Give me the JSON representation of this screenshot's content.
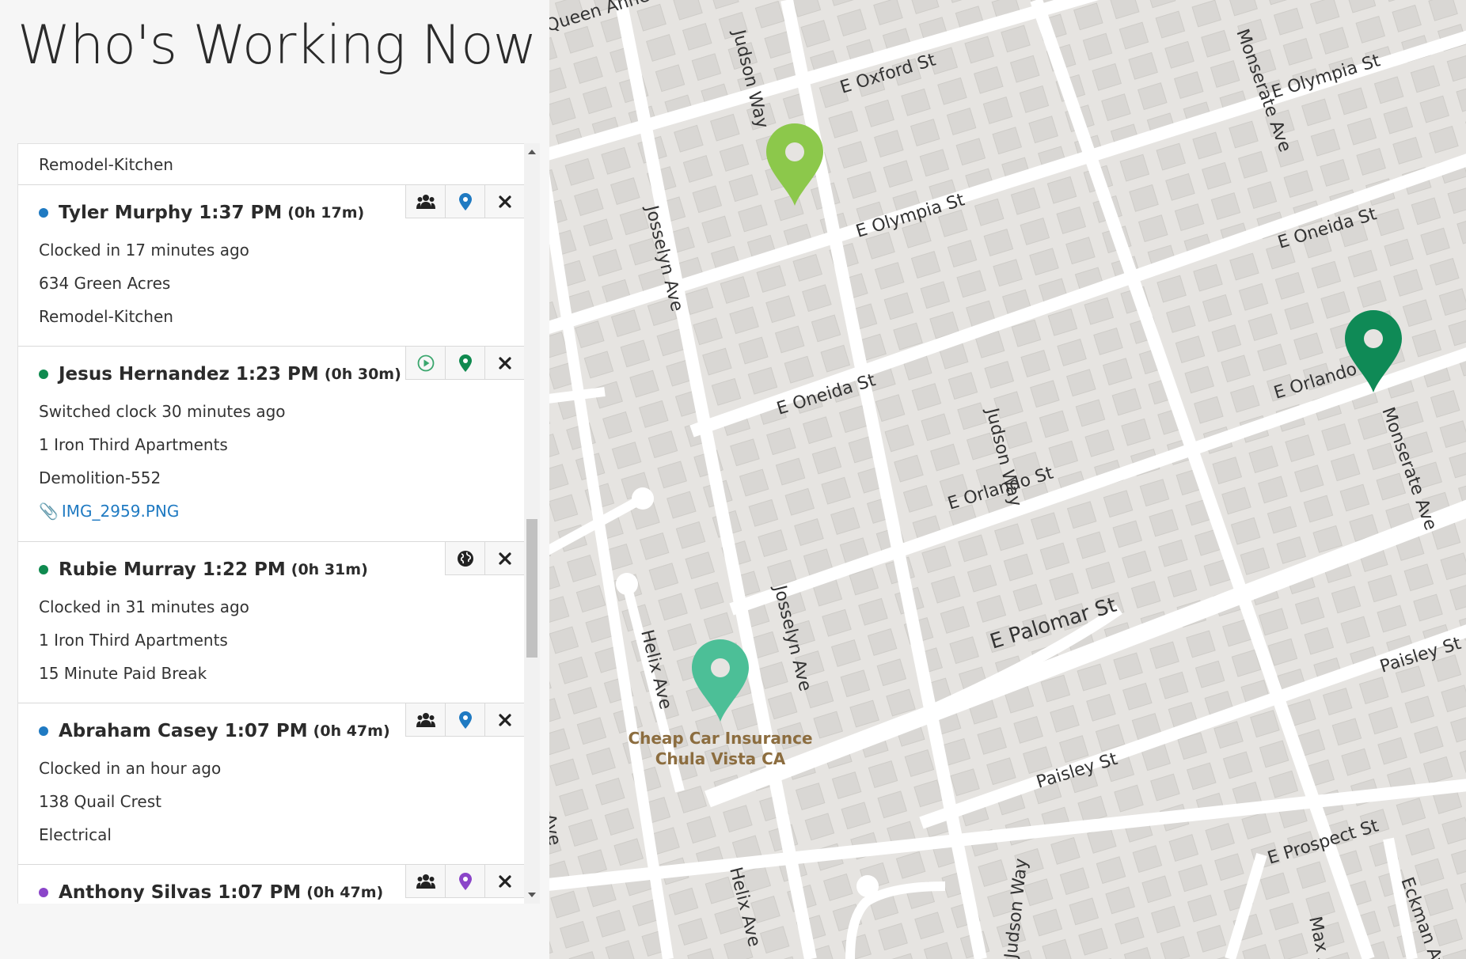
{
  "page": {
    "title": "Who's Working Now"
  },
  "top_entry": {
    "job": "Remodel-Kitchen"
  },
  "employees": [
    {
      "name": "Tyler Murphy",
      "clock_time": "1:37 PM",
      "duration": "(0h 17m)",
      "dot_color": "#1f7ac2",
      "status": "Clocked in 17 minutes ago",
      "location": "634 Green Acres",
      "job": "Remodel-Kitchen",
      "actions": [
        "group-icon",
        "map-pin-icon",
        "close-icon"
      ]
    },
    {
      "name": "Jesus Hernandez",
      "clock_time": "1:23 PM",
      "duration": "(0h 30m)",
      "dot_color": "#0f8a4f",
      "status": "Switched clock 30 minutes ago",
      "location": "1 Iron Third Apartments",
      "job": "Demolition-552",
      "attachment": "IMG_2959.PNG",
      "actions": [
        "play-circle-icon",
        "map-pin-icon",
        "close-icon"
      ]
    },
    {
      "name": "Rubie Murray",
      "clock_time": "1:22 PM",
      "duration": "(0h 31m)",
      "dot_color": "#0f8a4f",
      "status": "Clocked in 31 minutes ago",
      "location": "1 Iron Third Apartments",
      "job": "15 Minute Paid Break",
      "actions": [
        "globe-icon",
        "close-icon"
      ]
    },
    {
      "name": "Abraham Casey",
      "clock_time": "1:07 PM",
      "duration": "(0h 47m)",
      "dot_color": "#1f7ac2",
      "status": "Clocked in an hour ago",
      "location": "138 Quail Crest",
      "job": "Electrical",
      "actions": [
        "group-icon",
        "map-pin-icon",
        "close-icon"
      ]
    },
    {
      "name": "Anthony Silvas",
      "clock_time": "1:07 PM",
      "duration": "(0h 47m)",
      "dot_color": "#8b45c9",
      "actions": [
        "group-icon",
        "map-pin-icon",
        "close-icon"
      ]
    }
  ],
  "map": {
    "streets": [
      "Queen Anne Dr",
      "E Oxford St",
      "E Olympia St",
      "E Olympia St",
      "E Oneida St",
      "E Oneida St",
      "E Orlando",
      "E Orlando St",
      "E Palomar St",
      "Paisley St",
      "Paisley St",
      "E Prospect St",
      "Judson Way",
      "Judson Way",
      "Judson Way",
      "Monserate Ave",
      "Monserate Ave",
      "Josselyn Ave",
      "Josselyn Ave",
      "Helix Ave",
      "Helix Ave",
      "Eckman Ave",
      "Max Ave",
      "Ave"
    ],
    "poi": {
      "line1": "Cheap Car Insurance",
      "line2": "Chula Vista CA"
    },
    "markers": [
      {
        "name": "light-green-marker",
        "color": "#8cc84b"
      },
      {
        "name": "dark-green-marker",
        "color": "#0f8a56"
      },
      {
        "name": "teal-marker",
        "color": "#4cbf97"
      }
    ]
  }
}
